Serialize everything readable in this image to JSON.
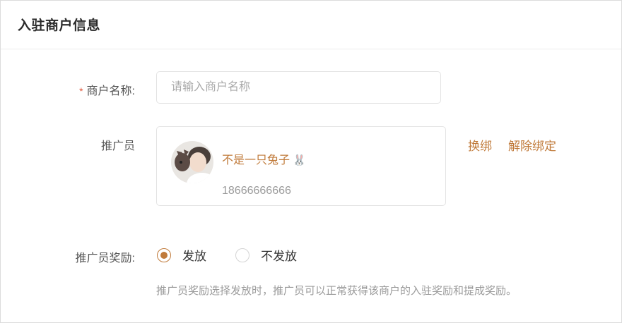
{
  "header": {
    "title": "入驻商户信息"
  },
  "form": {
    "merchant_name": {
      "required_mark": "*",
      "label": "商户名称:",
      "value": "",
      "placeholder": "请输入商户名称"
    },
    "promoter": {
      "label": "推广员",
      "name": "不是一只兔子",
      "name_emoji": "🐰",
      "phone": "18666666666",
      "avatar_icon": "user-avatar",
      "actions": {
        "change_label": "换绑",
        "unbind_label": "解除绑定"
      }
    },
    "reward": {
      "label": "推广员奖励:",
      "options": [
        {
          "label": "发放",
          "checked": true
        },
        {
          "label": "不发放",
          "checked": false
        }
      ],
      "hint": "推广员奖励选择发放时，推广员可以正常获得该商户的入驻奖励和提成奖励。"
    }
  },
  "colors": {
    "accent": "#c07a3a",
    "required": "#e05a3e"
  }
}
